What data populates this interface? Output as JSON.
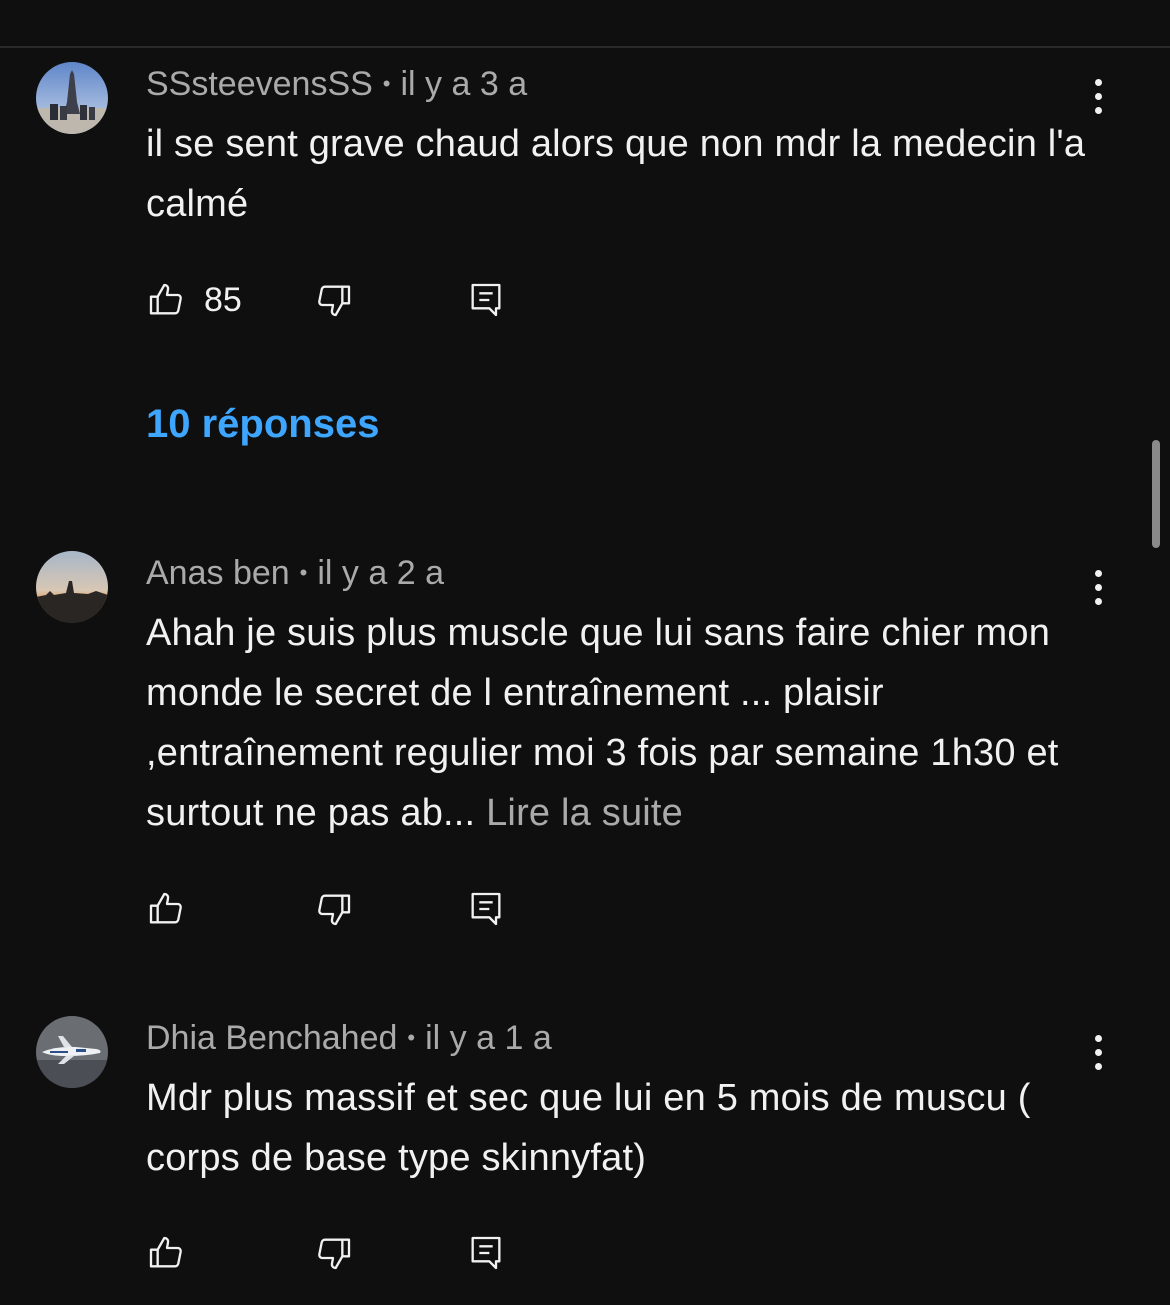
{
  "comments": [
    {
      "author": "SSsteevensSS",
      "time": "il y a 3 a",
      "text": "il se sent grave chaud alors que non mdr la medecin l'a calmé",
      "likes": "85",
      "avatar_icon": "avatar-photo-eiffel-tower"
    },
    {
      "author": "Anas ben",
      "time": "il y a 2 a",
      "text": "Ahah je suis plus  muscle que lui sans faire chier mon monde le secret de l entraînement  ... plaisir ,entraînement  regulier moi 3 fois par semaine 1h30 et surtout ne pas ab...",
      "read_more": "Lire la suite",
      "likes": "",
      "avatar_icon": "avatar-photo-sunset-skyline"
    },
    {
      "author": "Dhia Benchahed",
      "time": "il y a 1 a",
      "text": "Mdr plus massif et sec que lui en 5 mois de muscu ( corps de base type skinnyfat)",
      "likes": "",
      "avatar_icon": "avatar-photo-airplane"
    }
  ],
  "replies_label": "10 réponses",
  "separator": "•",
  "colors": {
    "background": "#0f0f0f",
    "text": "#f1f1f1",
    "meta": "#aaaaaa",
    "link": "#3ea6ff"
  },
  "icons": [
    "thumbs-up-icon",
    "thumbs-down-icon",
    "reply-icon",
    "more-vert-icon"
  ]
}
